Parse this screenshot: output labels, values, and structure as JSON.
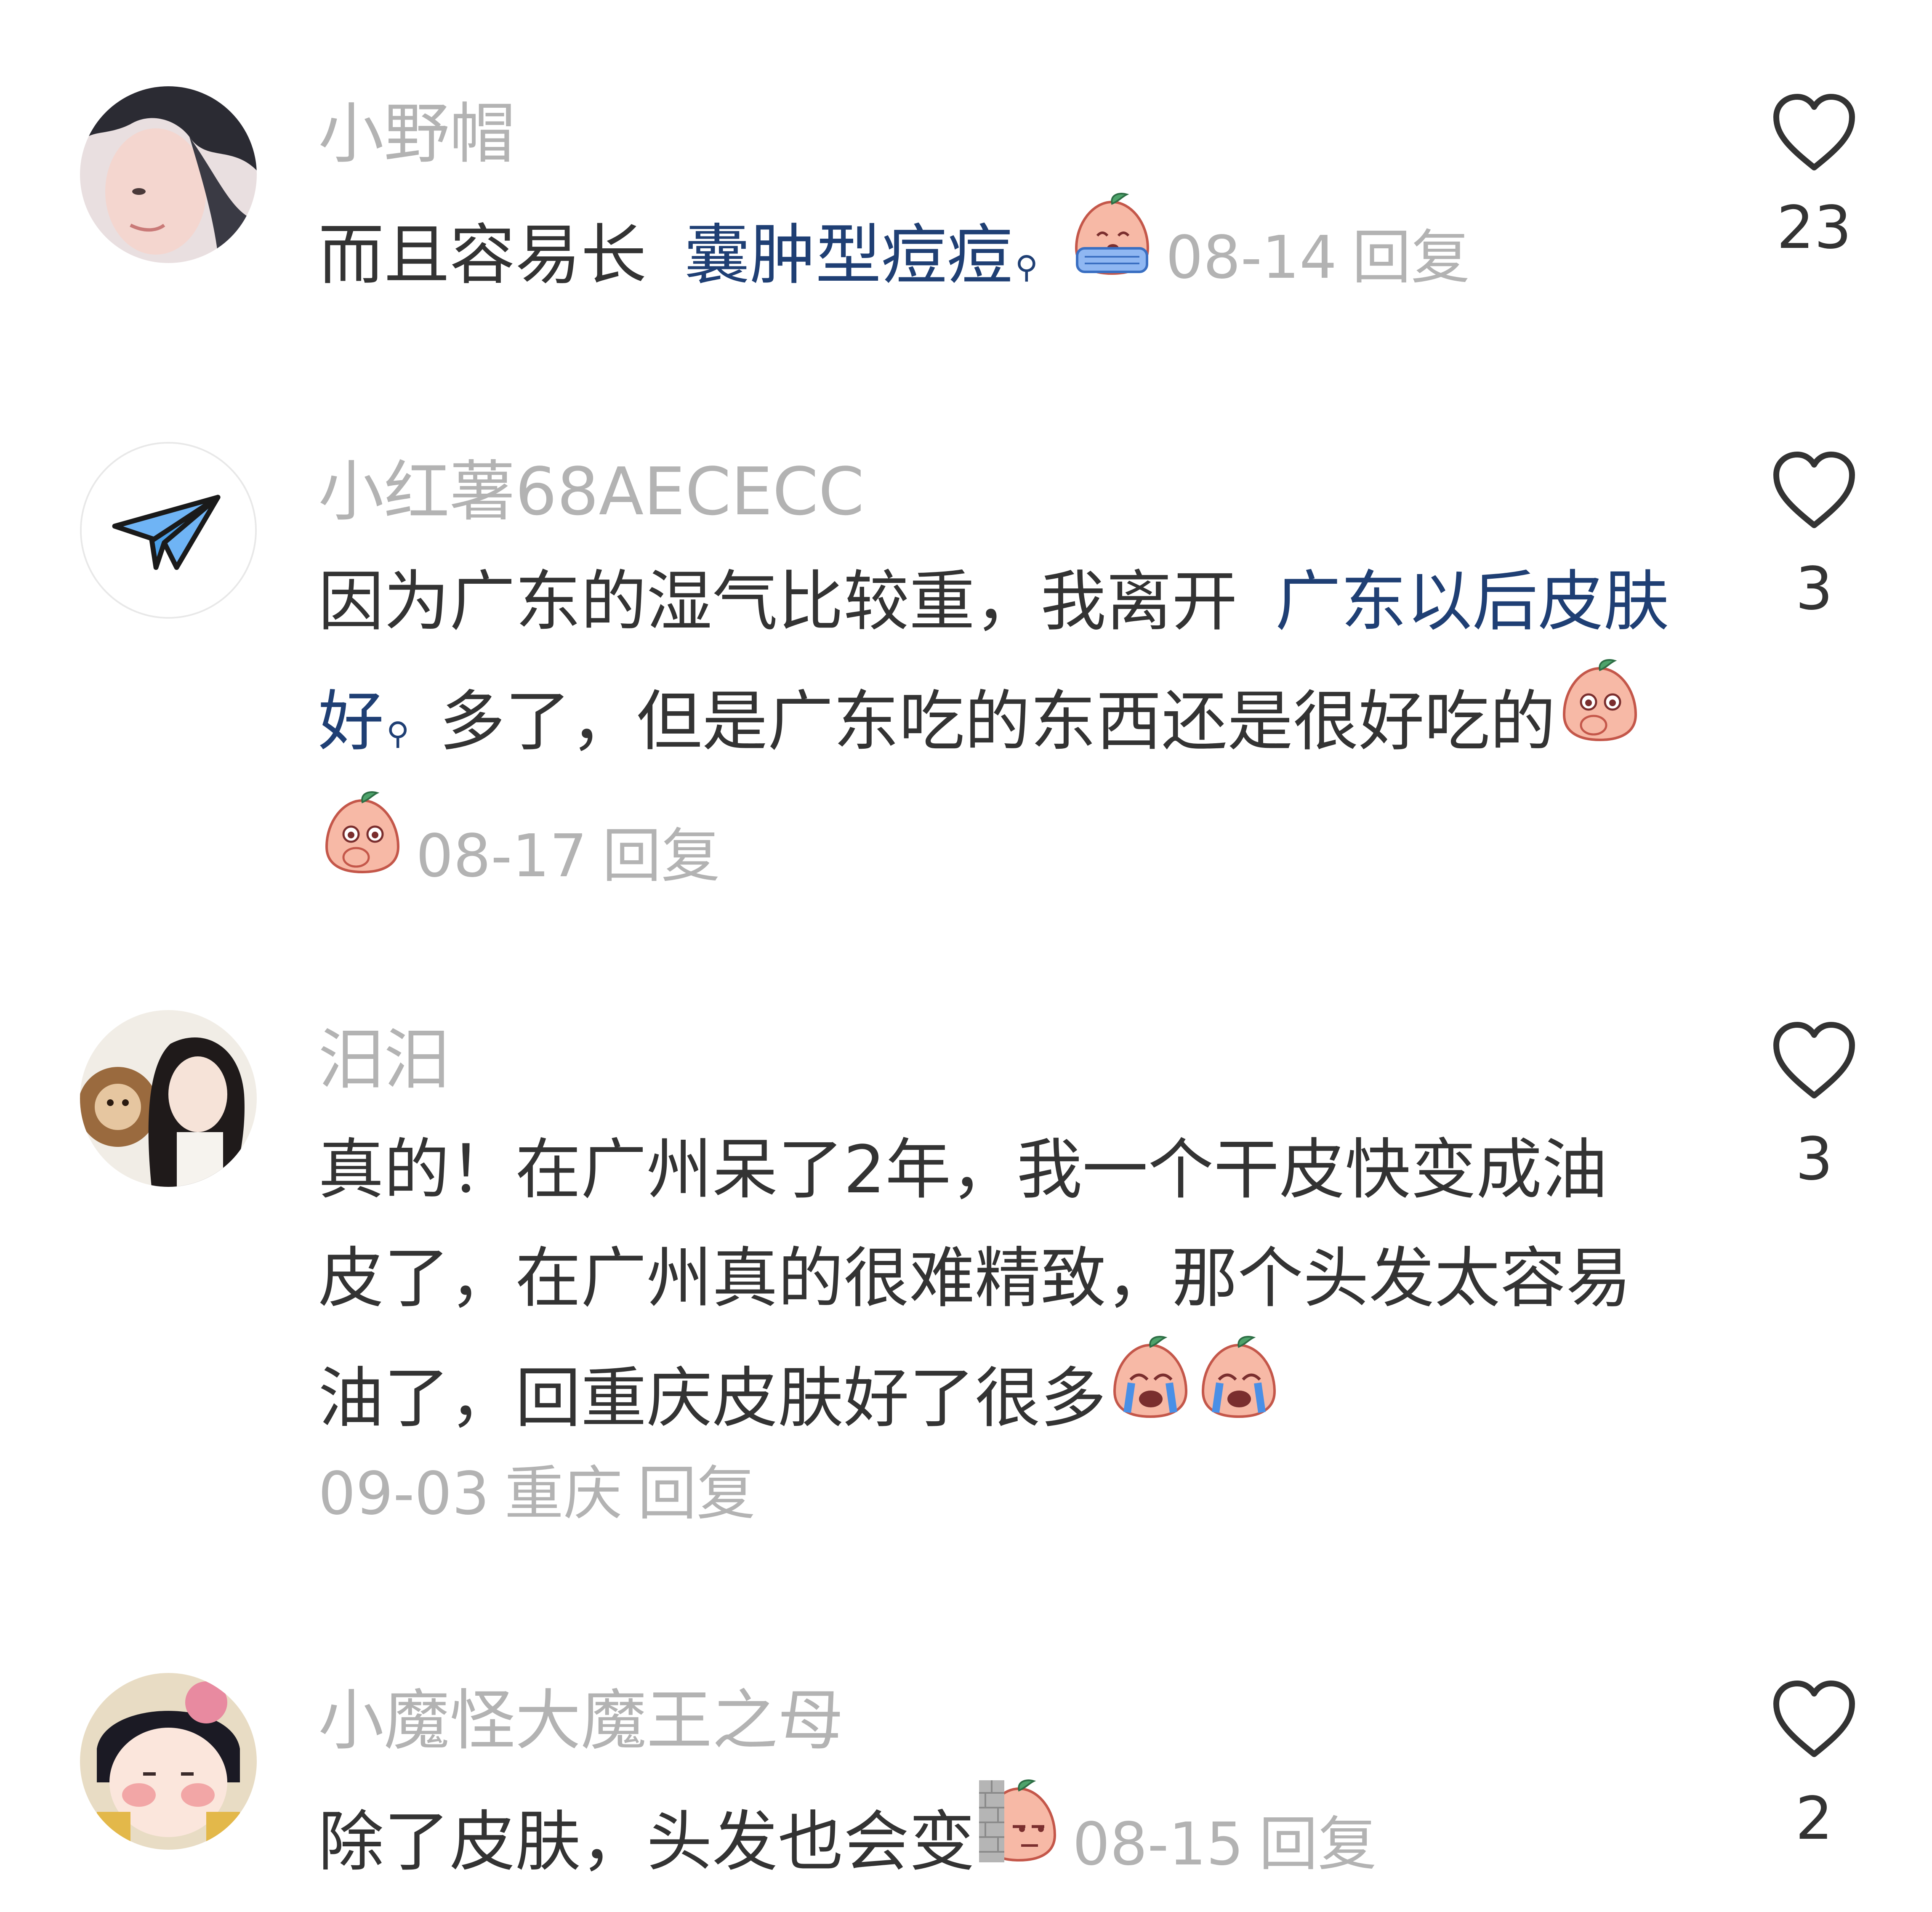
{
  "comments": [
    {
      "username": "小野帽",
      "text_1": "而且容易长",
      "link_1": "囊肿型痘痘",
      "date": "08-14",
      "reply": "回复",
      "likes": "23"
    },
    {
      "username": "小红薯68AECECC",
      "text_1": "因为广东的湿气比较重，我离开",
      "link_1": "广东以后皮肤好",
      "text_2": "多了，但是广东吃的东西还是很好吃的",
      "date": "08-17",
      "reply": "回复",
      "likes": "3"
    },
    {
      "username": "汨汨",
      "text_1": "真的！在广州呆了2年，我一个干皮快变成油皮了，在广州真的很难精致，那个头发太容易油了，回重庆皮肤好了很多",
      "date": "09-03",
      "location": "重庆",
      "reply": "回复",
      "likes": "3"
    },
    {
      "username": "小魔怪大魔王之母",
      "text_1": "除了皮肤，头发也会变",
      "date": "08-15",
      "reply": "回复",
      "likes": "2"
    }
  ],
  "icons": {
    "like": "heart-outline-icon",
    "search_hint": "magnifier-icon",
    "emoji_cry": "peach-crying-emoji",
    "emoji_shock": "peach-covering-mouth-emoji",
    "emoji_wall": "peach-peeking-wall-emoji"
  },
  "colors": {
    "username": "#b3b3b3",
    "text": "#333333",
    "link": "#1f3f74",
    "meta": "#b3b3b3"
  }
}
